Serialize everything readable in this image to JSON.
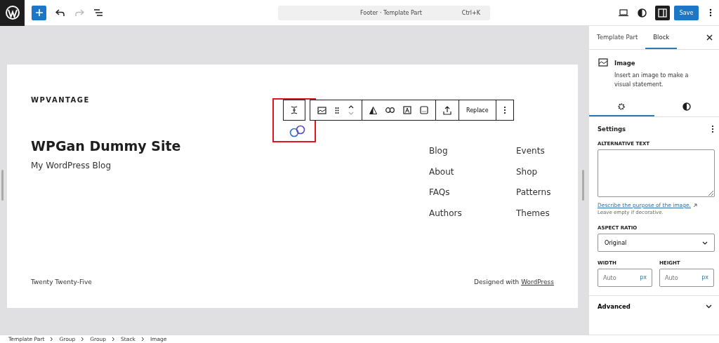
{
  "topbar": {
    "command": {
      "title": "Footer · Template Part",
      "shortcut": "Ctrl+K"
    },
    "sidebar_toggle": {
      "selected": true
    },
    "save": "Save"
  },
  "canvas": {
    "logo": "WPVANTAGE",
    "site_title": "WPGan Dummy Site",
    "tagline": "My WordPress Blog",
    "nav": [
      [
        "Blog",
        "About",
        "FAQs",
        "Authors"
      ],
      [
        "Events",
        "Shop",
        "Patterns",
        "Themes"
      ]
    ],
    "footer_left": "Twenty Twenty-Five",
    "footer_credit": "Designed with",
    "footer_link": "WordPress",
    "toolbar": {
      "replace": "Replace"
    }
  },
  "sidebar": {
    "tabs": [
      {
        "label": "Template Part",
        "selected": false
      },
      {
        "label": "Block",
        "selected": true
      }
    ],
    "block": {
      "name": "Image",
      "description": "Insert an image to make a visual statement."
    },
    "subtabs": [
      {
        "kind": "settings",
        "selected": true
      },
      {
        "kind": "styles",
        "selected": false
      }
    ],
    "settings_title": "Settings",
    "alt_label": "ALTERNATIVE TEXT",
    "alt_link": "Describe the purpose of the image.",
    "alt_help": "Leave empty if decorative.",
    "aspect_label": "ASPECT RATIO",
    "aspect_value": "Original",
    "width": {
      "label": "WIDTH",
      "placeholder": "Auto",
      "unit": "px"
    },
    "height": {
      "label": "HEIGHT",
      "placeholder": "Auto",
      "unit": "px"
    },
    "advanced": {
      "label": "Advanced",
      "expanded": false
    }
  },
  "breadcrumb": [
    "Template Part",
    "Group",
    "Group",
    "Stack",
    "Image"
  ]
}
